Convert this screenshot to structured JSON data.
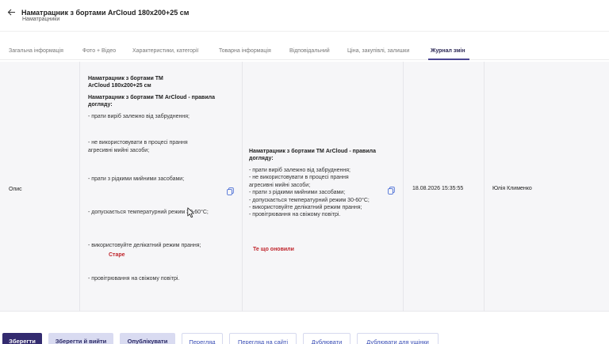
{
  "header": {
    "title": "Наматрацник з бортами ArCloud 180x200+25 см",
    "subtitle": "Наматрацники"
  },
  "tabs": [
    {
      "label": "Загальна інформація"
    },
    {
      "label": "Фото + Відео"
    },
    {
      "label": "Характеристики, категорії"
    },
    {
      "label": "Товарна інформація"
    },
    {
      "label": "Відповідальний"
    },
    {
      "label": "Ціна, закупівлі, залишки"
    },
    {
      "label": "Журнал змін",
      "active": true
    }
  ],
  "log_row": {
    "field": "Опис",
    "old_value": {
      "heading1": "Наматрацник з бортами ТМ",
      "heading2": "ArCloud 180x200+25 см",
      "heading3": "Наматрацник з бортами ТМ ArCloud - правила",
      "heading4": "догляду:",
      "lines": [
        "- прати виріб залежно від забруднення;",
        "- не використовувати в процесі прання",
        "агресивні мийні засоби;",
        "- прати з рідкими мийними засобами;",
        "- допускається температурний режим 30-60°С;",
        "- використовуйте делікатний режим прання;",
        "- провітрювання на свіжому повітрі."
      ],
      "tag": "Старе"
    },
    "new_value": {
      "heading1": "Наматрацник з бортами ТМ ArCloud - правила",
      "heading2": "догляду:",
      "lines": [
        "- прати виріб залежно від забруднення;",
        "- не використовувати в процесі прання",
        "агресивні мийні засоби;",
        "- прати з рідкими мийними засобами;",
        "- допускається температурний режим 30-60°С;",
        "- використовуйте делікатний режим прання;",
        "- провітрювання на свіжому повітрі."
      ],
      "tag": "Те що оновили"
    },
    "date": "18.08.2026 15:35:55",
    "user": "Юлія Клименко"
  },
  "buttons": {
    "save": "Зберегти",
    "save_exit": "Зберегти й вийти",
    "publish": "Опублікувати",
    "preview": "Перегляд",
    "preview_site": "Перегляд на сайті",
    "duplicate": "Дублювати",
    "duplicate_ukr": "Дублювати для ущінки"
  },
  "colors": {
    "primary": "#332b6f",
    "secondary": "#d9dbf1",
    "link": "#3b4fb6",
    "tag_red": "#c0262d",
    "tab_active": "#4b4693"
  },
  "icons": {
    "back": "arrow-left-icon",
    "copy": "copy-icon",
    "cursor": "mouse-pointer-icon"
  }
}
